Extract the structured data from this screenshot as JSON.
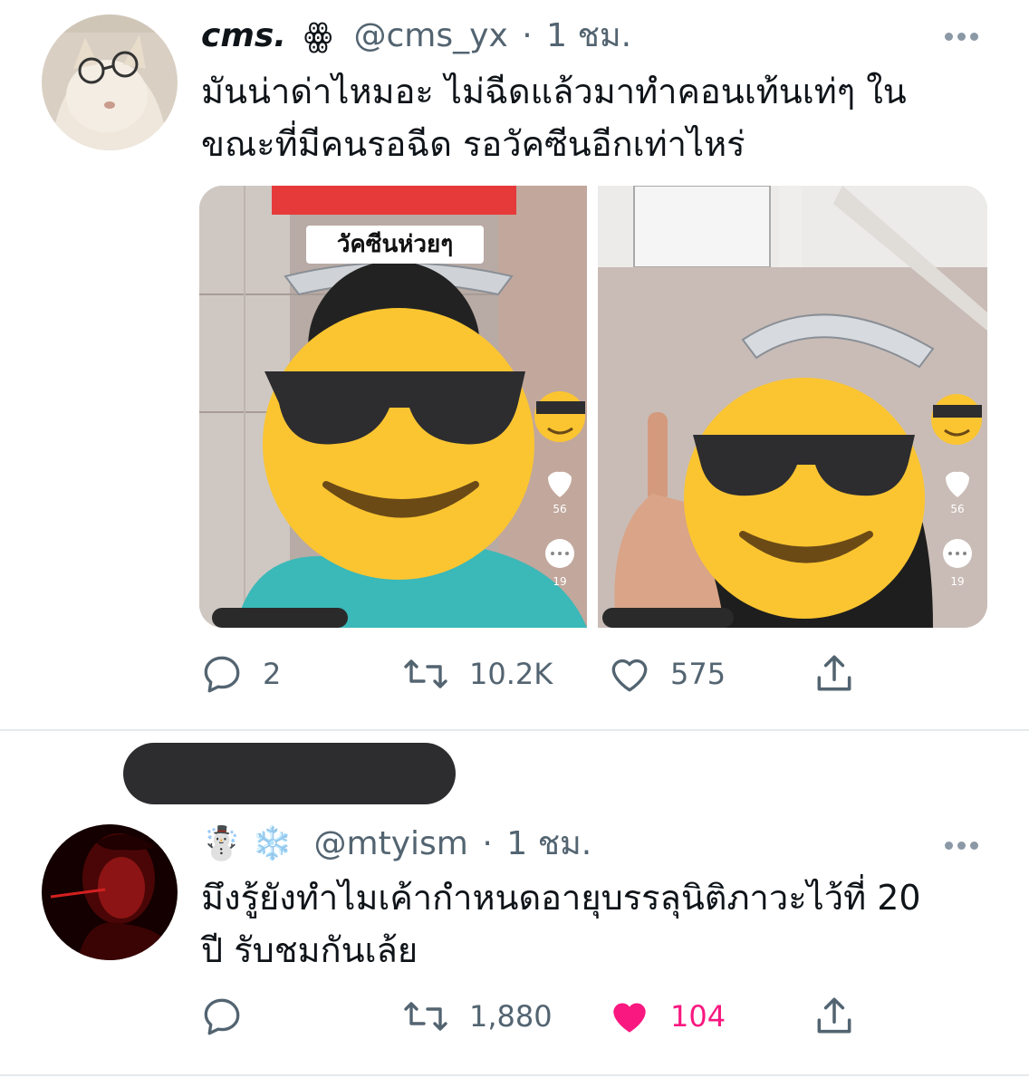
{
  "tweets": [
    {
      "display_name": "cms.",
      "name_emoji": "ꙮ",
      "handle": "@cms_yx",
      "separator": "·",
      "time": "1 ชม.",
      "text_line1": "มันน่าด่าไหมอะ ไม่ฉีดแล้วมาทำคอนเท้นเท่ๆ ใน",
      "text_line2": "ขณะที่มีคนรอฉีด รอวัคซีนอีกเท่าไหร่",
      "media": {
        "caption": "วัคซีนห่วยๆ",
        "panel_likes": [
          "56",
          "56"
        ],
        "panel_comments": [
          "19",
          "19"
        ]
      },
      "replies": "2",
      "retweets": "10.2K",
      "likes": "575",
      "liked": false
    },
    {
      "display_name_emoji": "☃️ ❄️",
      "handle": "@mtyism",
      "separator": "·",
      "time": "1 ชม.",
      "text_line1": "มึงรู้ยังทำไมเค้ากำหนดอายุบรรลุนิติภาวะไว้ที่ 20",
      "text_line2": "ปี รับชมกันเล้ย",
      "replies": "",
      "retweets": "1,880",
      "likes": "104",
      "liked": true
    }
  ],
  "colors": {
    "text": "#0f1419",
    "secondary": "#536471",
    "like_active": "#f91880",
    "emoji_face": "#fbc531",
    "divider": "#e6e9ec"
  }
}
